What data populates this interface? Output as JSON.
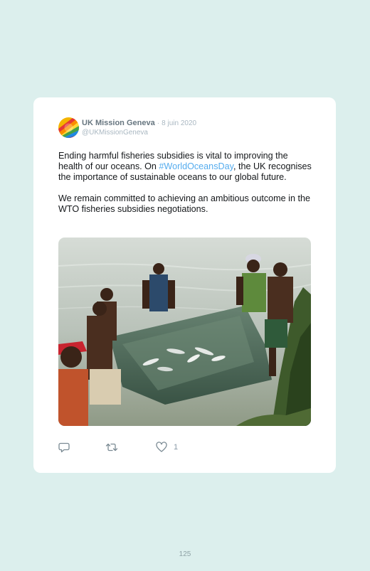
{
  "tweet": {
    "author_name": "UK Mission Geneva",
    "separator": "·",
    "date": "8 juin 2020",
    "handle": "@UKMissionGeneva",
    "paragraph1": {
      "before_hashtag": "Ending harmful fisheries subsidies is vital to improving the health of our oceans. On ",
      "hashtag": "#WorldOceansDay",
      "after_hashtag": ", the UK recognises the importance of sustainable oceans to our global future."
    },
    "paragraph2": "We remain committed to achieving an ambitious outcome in the WTO fisheries subsidies negotiations.",
    "actions": {
      "reply_icon": "reply-icon",
      "retweet_icon": "retweet-icon",
      "like_icon": "heart-icon",
      "like_count": "1"
    }
  },
  "page": {
    "number": "125"
  },
  "colors": {
    "background": "#dcefed",
    "card": "#ffffff",
    "hashtag": "#55acee",
    "muted": "#aab8c2",
    "author": "#66757f"
  }
}
